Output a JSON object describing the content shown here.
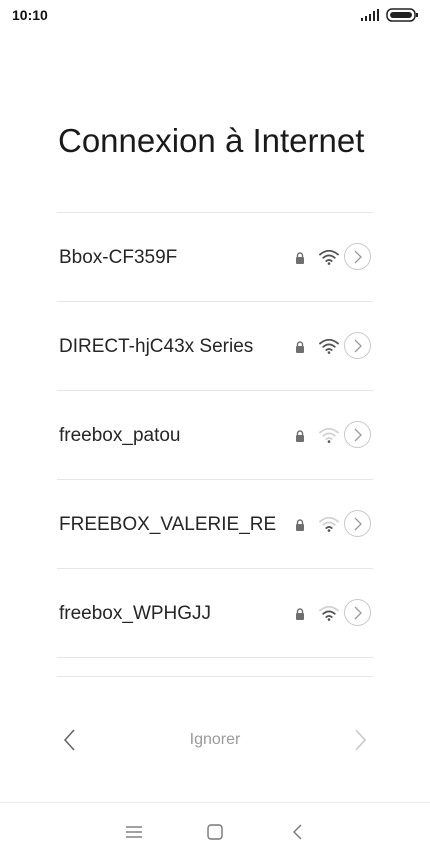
{
  "status_bar": {
    "time": "10:10"
  },
  "title": "Connexion à Internet",
  "networks": [
    {
      "name": "Bbox-CF359F",
      "secured": true,
      "signal": "strong"
    },
    {
      "name": "DIRECT-hjC43x Series",
      "secured": true,
      "signal": "strong"
    },
    {
      "name": "freebox_patou",
      "secured": true,
      "signal": "weak"
    },
    {
      "name": "FREEBOX_VALERIE_RE",
      "secured": true,
      "signal": "medium"
    },
    {
      "name": "freebox_WPHGJJ",
      "secured": true,
      "signal": "medium"
    }
  ],
  "footer": {
    "skip_label": "Ignorer"
  },
  "icons": {
    "status": [
      "signal-icon",
      "battery-icon"
    ],
    "row": [
      "lock-icon",
      "wifi-icon",
      "chevron-right-icon"
    ],
    "navigation": [
      "chevron-left-icon",
      "chevron-right-icon"
    ],
    "system": [
      "menu-icon",
      "home-square-icon",
      "back-chevron-icon"
    ]
  },
  "colors": {
    "text_primary": "#262626",
    "text_secondary": "#9a9a9a",
    "divider": "#e6e6e6",
    "icon": "#6f6f6f",
    "wifi_faint": "#cfcfcf"
  }
}
